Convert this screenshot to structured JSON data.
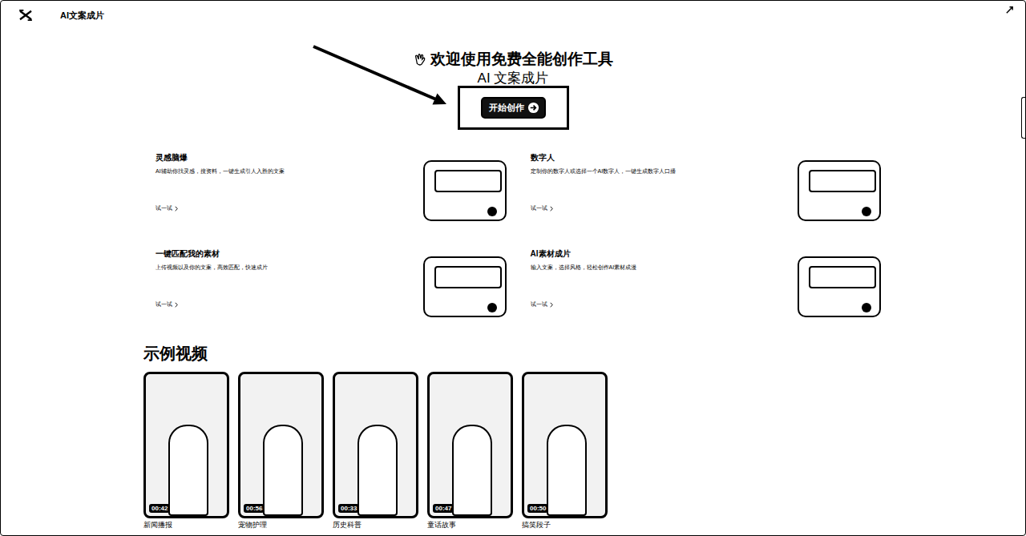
{
  "window": {
    "title": "AI文案成片"
  },
  "hero": {
    "heading": "欢迎使用免费全能创作工具",
    "subtitle": "AI 文案成片",
    "button": "开始创作"
  },
  "features": [
    {
      "title": "灵感脑爆",
      "description": "AI辅助你找灵感，搜资料，一键生成引人入胜的文案",
      "link": "试一试"
    },
    {
      "title": "数字人",
      "description": "定制你的数字人或选择一个AI数字人，一键生成数字人口播",
      "link": "试一试"
    },
    {
      "title": "一键匹配我的素材",
      "description": "上传视频以及你的文案，高效匹配，快速成片",
      "link": "试一试"
    },
    {
      "title": "AI素材成片",
      "description": "输入文案，选择风格，轻松创作AI素材成漫",
      "link": "试一试"
    }
  ],
  "examples": {
    "title": "示例视频",
    "videos": [
      {
        "duration": "00:42",
        "label": "新闻播报"
      },
      {
        "duration": "00:56",
        "label": "宠物护理"
      },
      {
        "duration": "00:33",
        "label": "历史科普"
      },
      {
        "duration": "00:47",
        "label": "童话故事"
      },
      {
        "duration": "00:50",
        "label": "搞笑段子"
      }
    ]
  }
}
